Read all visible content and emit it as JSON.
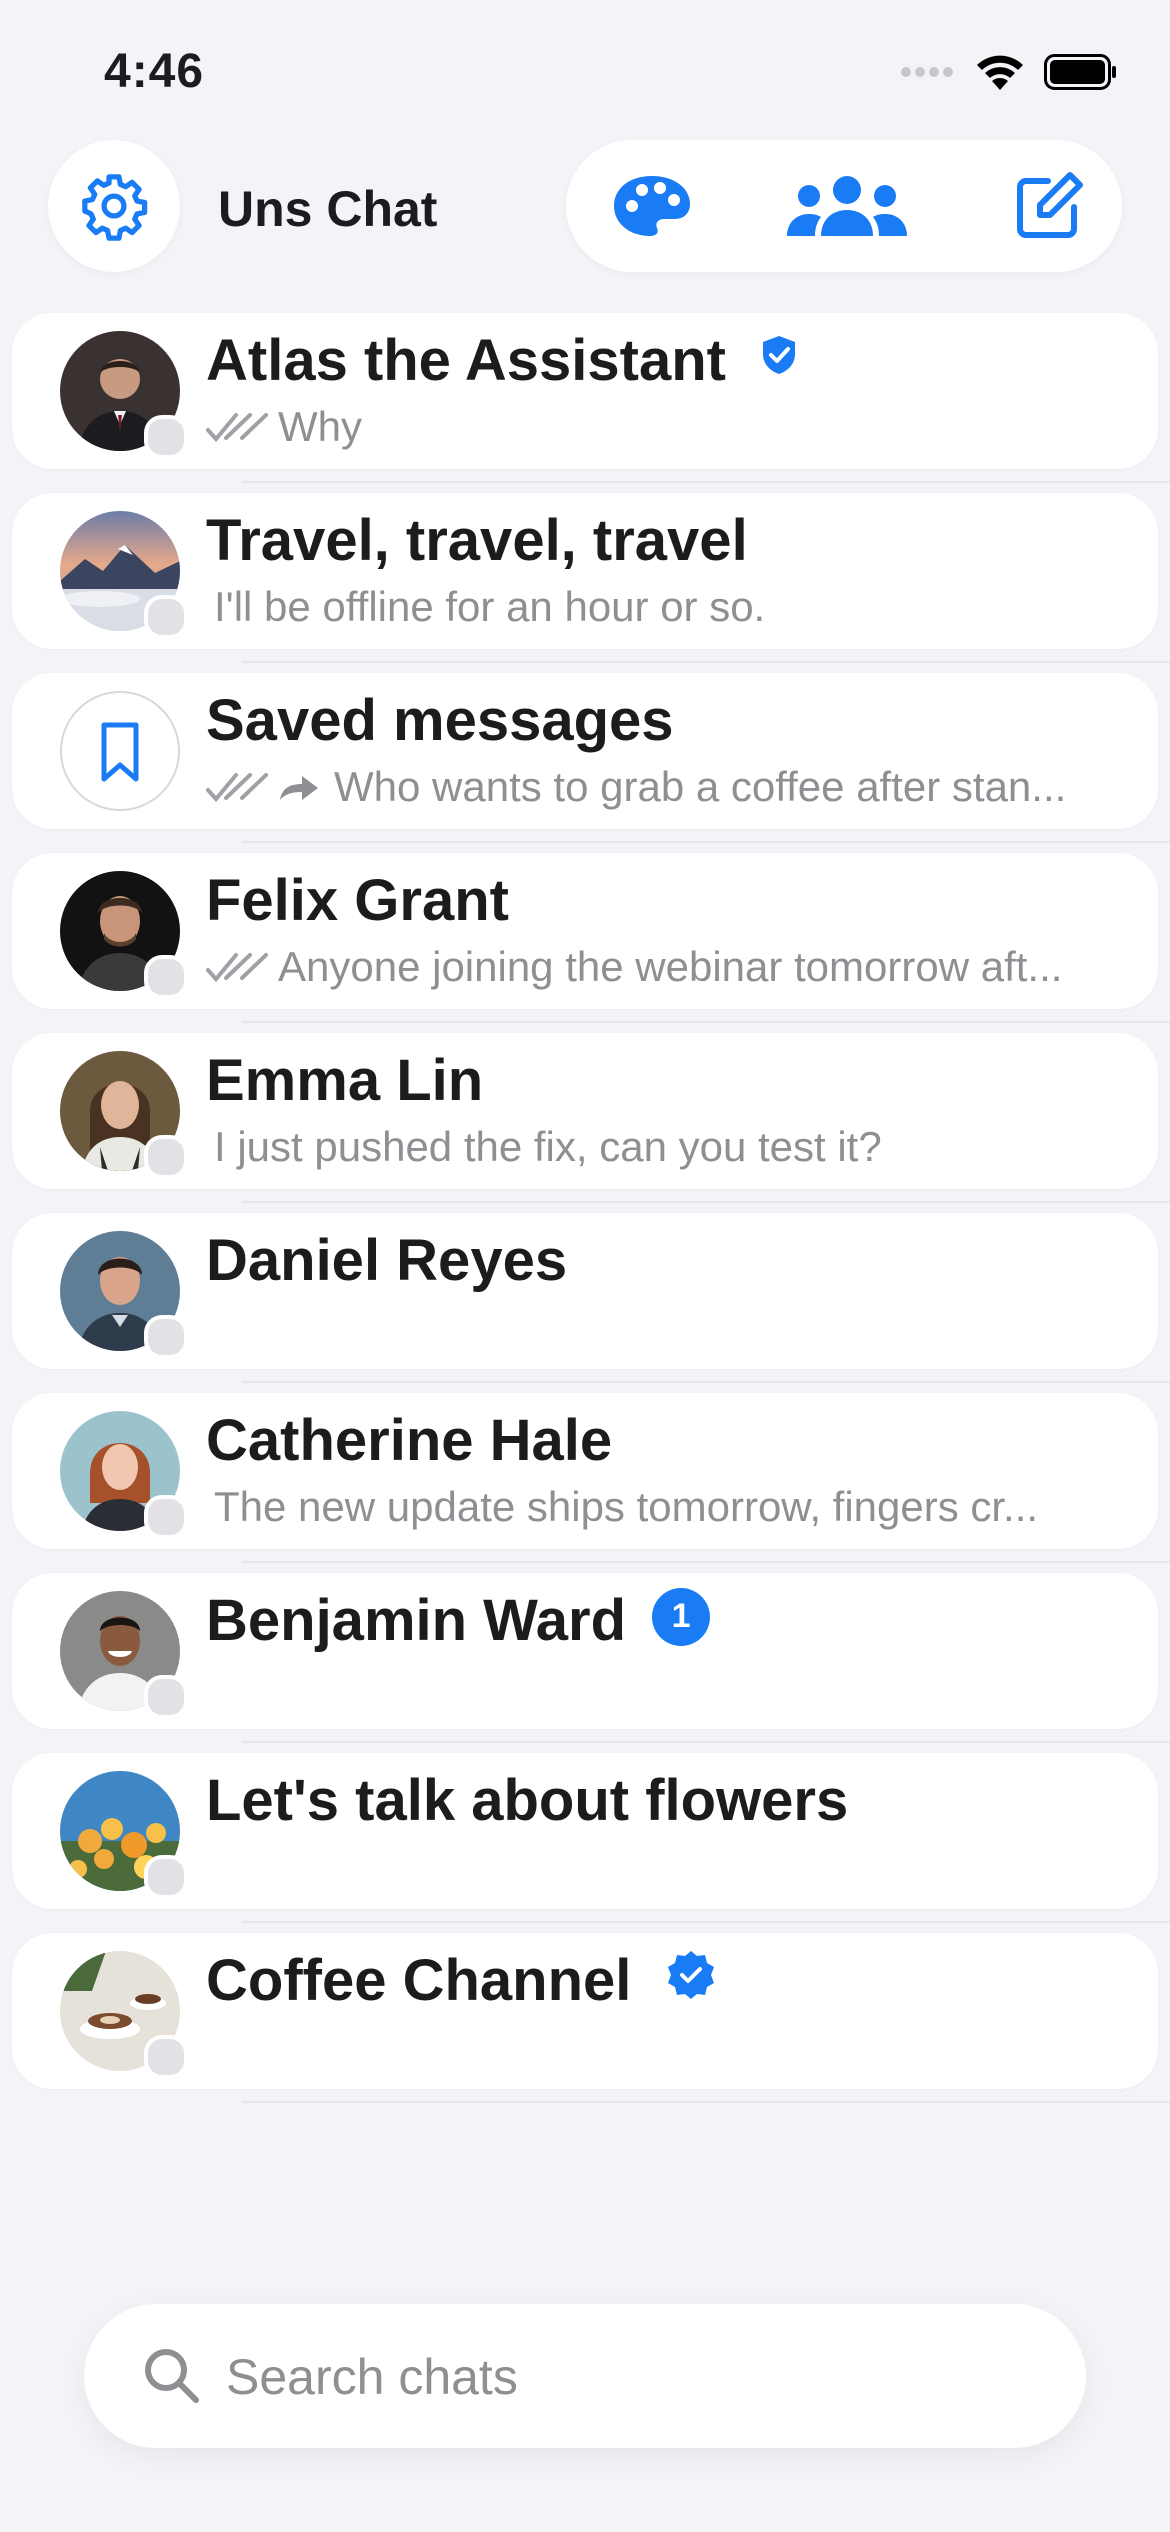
{
  "status_bar": {
    "time": "4:46",
    "icons": [
      "signal-dots-icon",
      "wifi-icon",
      "battery-icon"
    ]
  },
  "header": {
    "title": "Uns Chat",
    "settings_icon": "gear-icon",
    "actions": [
      "palette-icon",
      "group-icon",
      "compose-icon"
    ]
  },
  "colors": {
    "accent": "#1a7cf5",
    "background": "#f3f3f8",
    "card": "#ffffff",
    "muted": "#8e8e93"
  },
  "chats": [
    {
      "name": "Atlas the Assistant",
      "preview": "Why",
      "read_ticks": true,
      "forwarded": false,
      "badge": "verified-shield"
    },
    {
      "name": "Travel, travel, travel",
      "preview": "I'll be offline for an hour or so.",
      "read_ticks": false,
      "forwarded": false
    },
    {
      "name": "Saved messages",
      "preview": "Who wants to grab a coffee after stan...",
      "read_ticks": true,
      "forwarded": true,
      "avatar_icon": "bookmark-icon"
    },
    {
      "name": "Felix Grant",
      "preview": "Anyone joining the webinar tomorrow aft...",
      "read_ticks": true,
      "forwarded": false
    },
    {
      "name": "Emma Lin",
      "preview": "I just pushed the fix, can you test it?",
      "read_ticks": false,
      "forwarded": false
    },
    {
      "name": "Daniel Reyes",
      "preview": "",
      "read_ticks": false,
      "forwarded": false
    },
    {
      "name": "Catherine Hale",
      "preview": "The new update ships tomorrow, fingers cr...",
      "read_ticks": false,
      "forwarded": false
    },
    {
      "name": "Benjamin Ward",
      "preview": "",
      "read_ticks": false,
      "forwarded": false,
      "unread": "1"
    },
    {
      "name": "Let's talk about flowers",
      "preview": "",
      "read_ticks": false,
      "forwarded": false
    },
    {
      "name": "Coffee Channel",
      "preview": "",
      "read_ticks": false,
      "forwarded": false,
      "badge": "verified-seal"
    }
  ],
  "search": {
    "placeholder": "Search chats",
    "value": ""
  }
}
